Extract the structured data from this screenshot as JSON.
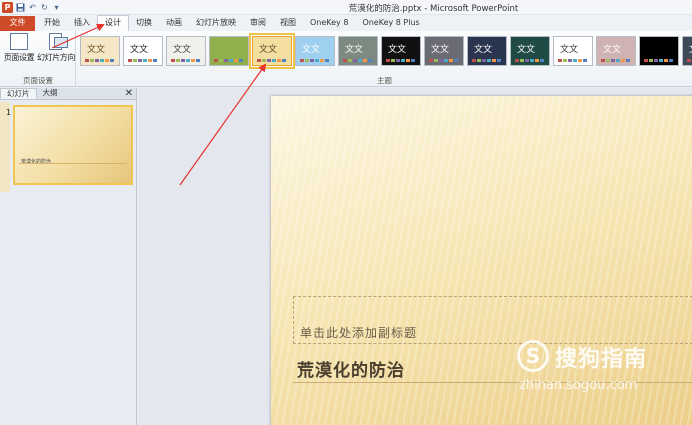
{
  "window": {
    "title": "荒漠化的防治.pptx - Microsoft PowerPoint",
    "app_icon_letter": "P"
  },
  "quick_access": {
    "save_icon": "save-icon",
    "undo_icon": "undo-icon",
    "redo_icon": "redo-icon",
    "customize_icon": "customize-icon"
  },
  "ribbon_tabs": {
    "file": "文件",
    "items": [
      "开始",
      "插入",
      "设计",
      "切换",
      "动画",
      "幻灯片放映",
      "审阅",
      "视图",
      "OneKey 8",
      "OneKey 8 Plus"
    ],
    "active": "设计"
  },
  "page_setup_group": {
    "page_setup_label": "页面设置",
    "orientation_label": "幻灯片方向",
    "group_label": "页面设置"
  },
  "themes_group": {
    "group_label": "主题",
    "themes": [
      {
        "label": "文文",
        "bg": "#f5e7c6",
        "fg": "#6b4a1e"
      },
      {
        "label": "文文",
        "bg": "#ffffff",
        "fg": "#222222"
      },
      {
        "label": "文文",
        "bg": "#f1f1ec",
        "fg": "#444444"
      },
      {
        "label": "",
        "bg": "#8fb04a",
        "fg": "#ffffff"
      },
      {
        "label": "文文",
        "bg": "#f3dea0",
        "fg": "#5b4a2a",
        "selected": true
      },
      {
        "label": "文文",
        "bg": "#9fd0ef",
        "fg": "#ffffff"
      },
      {
        "label": "文文",
        "bg": "#7d8a82",
        "fg": "#ffffff"
      },
      {
        "label": "文文",
        "bg": "#111111",
        "fg": "#ffffff"
      },
      {
        "label": "文文",
        "bg": "#6b6b73",
        "fg": "#ffffff"
      },
      {
        "label": "文文",
        "bg": "#2a3550",
        "fg": "#ffffff"
      },
      {
        "label": "文文",
        "bg": "#1f4a46",
        "fg": "#ffffff"
      },
      {
        "label": "文文",
        "bg": "#ffffff",
        "fg": "#333333"
      },
      {
        "label": "文文",
        "bg": "#cfb3b3",
        "fg": "#ffffff"
      },
      {
        "label": "",
        "bg": "#000000",
        "fg": "#ffffff"
      },
      {
        "label": "文",
        "bg": "#3d4a5a",
        "fg": "#ffffff"
      }
    ]
  },
  "left_pane": {
    "tab_slides": "幻灯片",
    "tab_outline": "大纲",
    "close_icon": "close-icon",
    "slide_number": "1",
    "thumb_title": "荒漠化的防治"
  },
  "slide": {
    "subtitle_placeholder": "单击此处添加副标题",
    "title": "荒漠化的防治"
  },
  "watermark": {
    "logo": "S",
    "brand": "搜狗指南",
    "url": "zhinan.sogou.com"
  },
  "colors": {
    "accent_file_tab": "#cf4a26",
    "annotation_arrow": "#e5322d"
  }
}
